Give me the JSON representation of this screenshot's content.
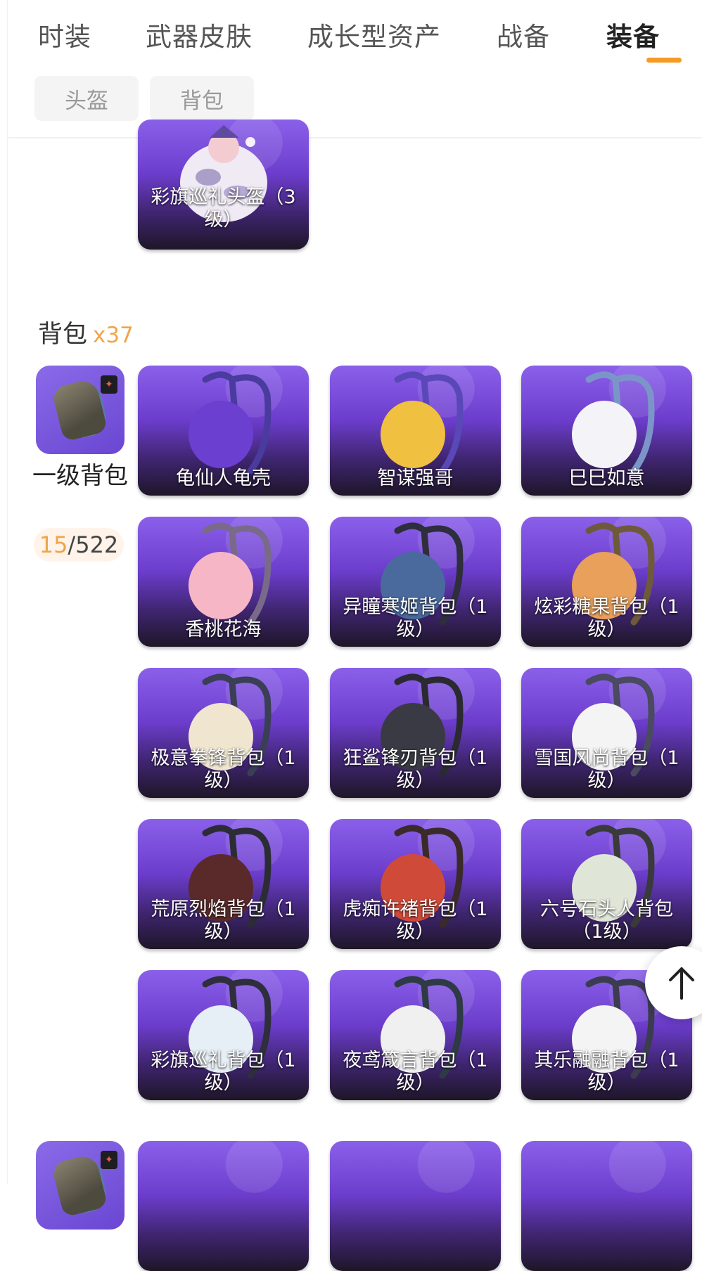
{
  "tabs": [
    {
      "label": "时装",
      "active": false
    },
    {
      "label": "武器皮肤",
      "active": false
    },
    {
      "label": "成长型资产",
      "active": false
    },
    {
      "label": "战备",
      "active": false
    },
    {
      "label": "装备",
      "active": true
    }
  ],
  "subtabs": [
    "头盔",
    "背包"
  ],
  "helmet_section": {
    "last_item": {
      "name": "彩旗巡礼头盔（3级）"
    }
  },
  "backpack_section": {
    "title": "背包",
    "count": "x37",
    "category": {
      "name": "一级背包",
      "owned": "15",
      "total": "/522",
      "badge_icon": "rocket-badge-icon"
    },
    "items": [
      {
        "name": "龟仙人龟壳"
      },
      {
        "name": "智谋强哥"
      },
      {
        "name": "巳巳如意"
      },
      {
        "name": "香桃花海"
      },
      {
        "name": "异瞳寒姬背包（1级）"
      },
      {
        "name": "炫彩糖果背包（1级）"
      },
      {
        "name": "极意拳锋背包（1级）"
      },
      {
        "name": "狂鲨锋刃背包（1级）"
      },
      {
        "name": "雪国风尚背包（1级）"
      },
      {
        "name": "荒原烈焰背包（1级）"
      },
      {
        "name": "虎痴许褚背包（1级）"
      },
      {
        "name": "六号石头人背包（1级）"
      },
      {
        "name": "彩旗巡礼背包（1级）"
      },
      {
        "name": "夜鸢箴言背包（1级）"
      },
      {
        "name": "其乐融融背包（1级）"
      }
    ]
  },
  "scroll_top_button": {
    "icon": "arrow-up-icon"
  },
  "colors": {
    "accent": "#f59a23",
    "card_top": "#8a60ea",
    "card_bottom": "#1e1628",
    "count_owned": "#f0a54a"
  }
}
